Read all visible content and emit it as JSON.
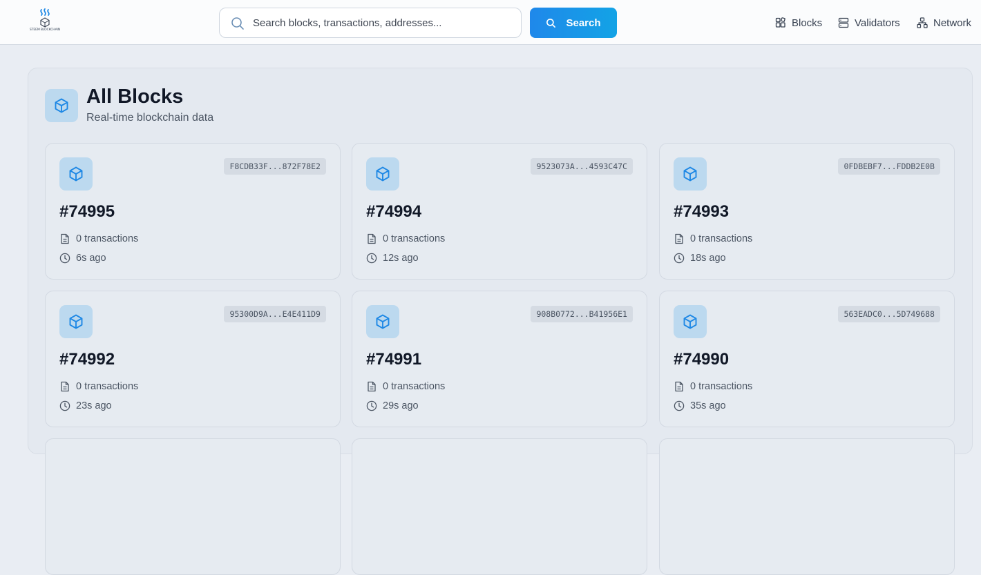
{
  "brand": {
    "logo_text": "STEEM BLOCKCHAIN",
    "logo_icon": "steem-logo-icon"
  },
  "search": {
    "placeholder": "Search blocks, transactions, addresses...",
    "value": "",
    "button_label": "Search",
    "icon": "search-icon"
  },
  "nav": {
    "items": [
      {
        "label": "Blocks",
        "icon": "blocks-icon"
      },
      {
        "label": "Validators",
        "icon": "server-icon"
      },
      {
        "label": "Network",
        "icon": "network-icon"
      }
    ]
  },
  "page": {
    "title": "All Blocks",
    "subtitle": "Real-time blockchain data",
    "icon": "cube-icon"
  },
  "blocks": [
    {
      "number": "#74995",
      "hash": "F8CDB33F...872F78E2",
      "transactions": "0 transactions",
      "age": "6s ago"
    },
    {
      "number": "#74994",
      "hash": "9523073A...4593C47C",
      "transactions": "0 transactions",
      "age": "12s ago"
    },
    {
      "number": "#74993",
      "hash": "0FDBEBF7...FDDB2E0B",
      "transactions": "0 transactions",
      "age": "18s ago"
    },
    {
      "number": "#74992",
      "hash": "95300D9A...E4E411D9",
      "transactions": "0 transactions",
      "age": "23s ago"
    },
    {
      "number": "#74991",
      "hash": "908B0772...B41956E1",
      "transactions": "0 transactions",
      "age": "29s ago"
    },
    {
      "number": "#74990",
      "hash": "563EADC0...5D749688",
      "transactions": "0 transactions",
      "age": "35s ago"
    }
  ],
  "colors": {
    "accent": "#1f88ea",
    "icon_blue": "#1e88e5",
    "icon_tile": "#bcd9ef",
    "page_bg": "#e9edf3"
  }
}
